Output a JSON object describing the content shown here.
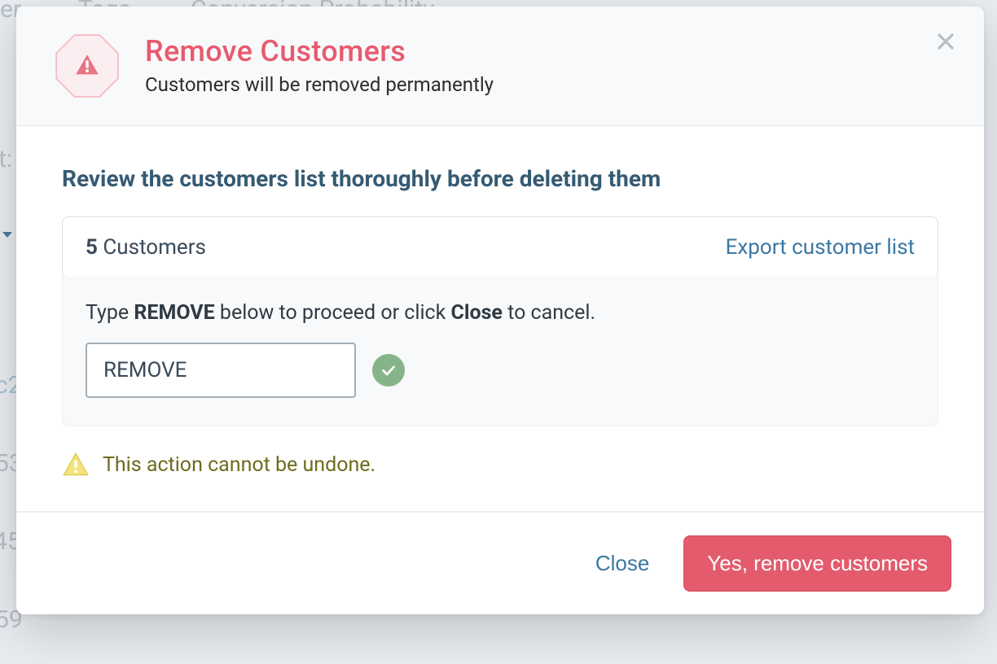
{
  "background": {
    "col1": "er",
    "col2": "Tags",
    "col3": "Conversion Probability",
    "side_label": "t:",
    "side_link": "c2",
    "row1": "53",
    "row2": "45",
    "row3": "59"
  },
  "modal": {
    "title": "Remove Customers",
    "subtitle": "Customers will be removed permanently",
    "review_heading": "Review the customers list thoroughly before deleting them",
    "customer_count": "5",
    "customer_count_label": "Customers",
    "export_link": "Export customer list",
    "confirm": {
      "prefix": "Type ",
      "keyword": "REMOVE",
      "middle": " below to proceed or click ",
      "close_word": "Close",
      "suffix": " to cancel.",
      "input_value": "REMOVE"
    },
    "warning_text": "This action cannot be undone.",
    "footer": {
      "close": "Close",
      "confirm": "Yes, remove customers"
    }
  }
}
